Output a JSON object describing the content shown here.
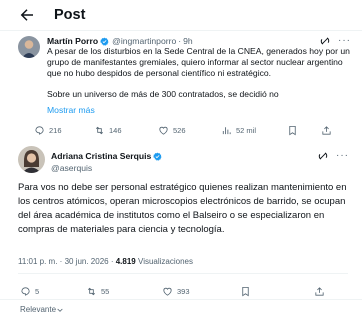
{
  "header": {
    "title": "Post"
  },
  "tweet1": {
    "name": "Martín Porro",
    "handle": "@ingmartinporro",
    "time": "9h",
    "body": [
      "A pesar de los disturbios en la Sede Central de la CNEA, generados hoy por un grupo de manifestantes gremiales, quiero informar al sector nuclear argentino que no hubo despidos de personal científico ni estratégico.",
      "Sobre un universo de más de 300 contratados, se decidió no"
    ],
    "show_more": "Mostrar más",
    "replies": "216",
    "reposts": "146",
    "likes": "526",
    "views": "52 mil"
  },
  "tweet2": {
    "name": "Adriana Cristina Serquis",
    "handle": "@aserquis",
    "body": "Para vos no debe ser personal estratégico quienes realizan mantenimiento en los centros atómicos, operan microscopios electrónicos de barrido, se ocupan del área académica de institutos como el Balseiro o se especializaron en compras de materiales para ciencia y tecnología.",
    "time": "11:01 p. m.",
    "date": "30 jun. 2026",
    "views_count": "4.819",
    "views_label": "Visualizaciones",
    "replies": "5",
    "reposts": "55",
    "likes": "393"
  },
  "sort": {
    "label": "Relevante"
  },
  "colors": {
    "accent": "#1d9bf0",
    "muted": "#536471",
    "text": "#0f1419"
  }
}
